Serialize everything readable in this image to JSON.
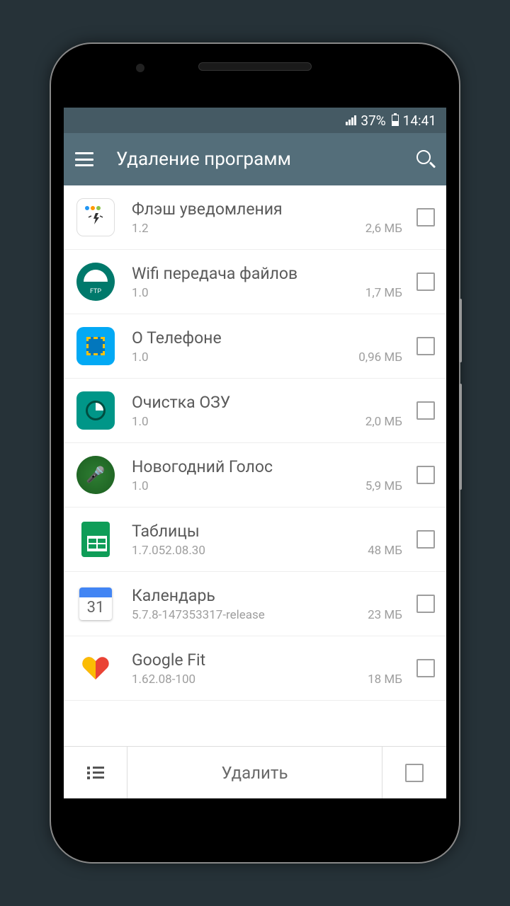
{
  "status": {
    "battery": "37%",
    "time": "14:41"
  },
  "appbar": {
    "title": "Удаление программ"
  },
  "apps": [
    {
      "name": "Флэш уведомления",
      "version": "1.2",
      "size": "2,6 МБ"
    },
    {
      "name": "Wifi передача файлов",
      "version": "1.0",
      "size": "1,7 МБ"
    },
    {
      "name": "О Телефоне",
      "version": "1.0",
      "size": "0,96 МБ"
    },
    {
      "name": "Очистка ОЗУ",
      "version": "1.0",
      "size": "2,0 МБ"
    },
    {
      "name": "Новогодний Голос",
      "version": "1.0",
      "size": "5,9 МБ"
    },
    {
      "name": "Таблицы",
      "version": "1.7.052.08.30",
      "size": "48 МБ"
    },
    {
      "name": "Календарь",
      "version": "5.7.8-147353317-release",
      "size": "23 МБ"
    },
    {
      "name": "Google Fit",
      "version": "1.62.08-100",
      "size": "18 МБ"
    }
  ],
  "bottom": {
    "delete": "Удалить"
  }
}
